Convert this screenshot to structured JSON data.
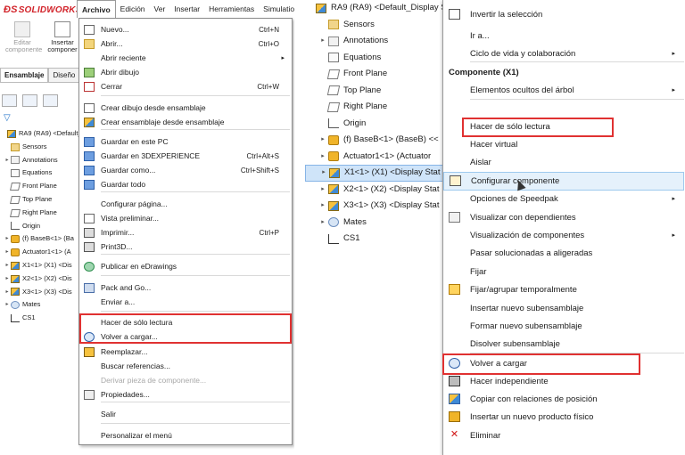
{
  "left": {
    "logo": "SOLIDWORKS",
    "menus": [
      "Archivo",
      "Edición",
      "Ver",
      "Insertar",
      "Herramientas",
      "Simulation"
    ],
    "toolbar": {
      "edit_label": "Editar\ncomponente",
      "insert_label": "Insertar\ncomponer"
    },
    "tabs": [
      "Ensamblaje",
      "Diseño"
    ],
    "tree": [
      {
        "label": "RA9 (RA9) <Default_",
        "icon": "asm",
        "expand": ""
      },
      {
        "label": "Sensors",
        "icon": "folder",
        "expand": ""
      },
      {
        "label": "Annotations",
        "icon": "ann",
        "expand": "▸"
      },
      {
        "label": "Equations",
        "icon": "eq",
        "expand": ""
      },
      {
        "label": "Front Plane",
        "icon": "plane",
        "expand": ""
      },
      {
        "label": "Top Plane",
        "icon": "plane",
        "expand": ""
      },
      {
        "label": "Right Plane",
        "icon": "plane",
        "expand": ""
      },
      {
        "label": "Origin",
        "icon": "origin",
        "expand": ""
      },
      {
        "label": "(f) BaseB<1> (Ba",
        "icon": "part",
        "expand": "▸"
      },
      {
        "label": "Actuator1<1> (A",
        "icon": "part",
        "expand": "▸"
      },
      {
        "label": "X1<1> (X1) <Dis",
        "icon": "asm",
        "expand": "▸"
      },
      {
        "label": "X2<1> (X2) <Dis",
        "icon": "asm",
        "expand": "▸"
      },
      {
        "label": "X3<1> (X3) <Dis",
        "icon": "asm",
        "expand": "▸"
      },
      {
        "label": "Mates",
        "icon": "mates",
        "expand": "▸"
      },
      {
        "label": "CS1",
        "icon": "cs",
        "expand": ""
      }
    ],
    "archivo_menu": {
      "items": [
        {
          "label": "Nuevo...",
          "shortcut": "Ctrl+N",
          "icon": "doc-icon"
        },
        {
          "label": "Abrir...",
          "shortcut": "Ctrl+O",
          "icon": "open-icon"
        },
        {
          "label": "Abrir reciente",
          "shortcut": "",
          "icon": "none",
          "submenu": true
        },
        {
          "label": "Abrir dibujo",
          "shortcut": "",
          "icon": "pic-icon"
        },
        {
          "label": "Cerrar",
          "shortcut": "Ctrl+W",
          "icon": "close-icon"
        },
        {
          "label": "Crear dibujo desde ensamblaje",
          "shortcut": "",
          "icon": "doc-icon"
        },
        {
          "label": "Crear ensamblaje desde ensamblaje",
          "shortcut": "",
          "icon": "asm-icon"
        },
        {
          "label": "Guardar en este PC",
          "shortcut": "",
          "icon": "save-icon"
        },
        {
          "label": "Guardar en 3DEXPERIENCE",
          "shortcut": "Ctrl+Alt+S",
          "icon": "save-icon"
        },
        {
          "label": "Guardar como...",
          "shortcut": "Ctrl+Shift+S",
          "icon": "save-icon"
        },
        {
          "label": "Guardar todo",
          "shortcut": "",
          "icon": "save-icon"
        },
        {
          "label": "Configurar página...",
          "shortcut": "",
          "icon": "none"
        },
        {
          "label": "Vista preliminar...",
          "shortcut": "",
          "icon": "doc-icon"
        },
        {
          "label": "Imprimir...",
          "shortcut": "Ctrl+P",
          "icon": "print-icon"
        },
        {
          "label": "Print3D...",
          "shortcut": "",
          "icon": "print-icon"
        },
        {
          "label": "Publicar en eDrawings",
          "shortcut": "",
          "icon": "edraw-icon"
        },
        {
          "label": "Pack and Go...",
          "shortcut": "",
          "icon": "pack-icon"
        },
        {
          "label": "Enviar a...",
          "shortcut": "",
          "icon": "none"
        },
        {
          "label": "Hacer de sólo lectura",
          "shortcut": "",
          "icon": "none"
        },
        {
          "label": "Volver a cargar...",
          "shortcut": "",
          "icon": "reload-icon"
        },
        {
          "label": "Reemplazar...",
          "shortcut": "",
          "icon": "replace-icon"
        },
        {
          "label": "Buscar referencias...",
          "shortcut": "",
          "icon": "none"
        },
        {
          "label": "Derivar pieza de componente...",
          "shortcut": "",
          "icon": "none",
          "disabled": true
        },
        {
          "label": "Propiedades...",
          "shortcut": "",
          "icon": "props-icon"
        },
        {
          "label": "Salir",
          "shortcut": "",
          "icon": "none"
        },
        {
          "label": "Personalizar el menú",
          "shortcut": "",
          "icon": "none"
        }
      ]
    }
  },
  "right": {
    "tree": [
      {
        "label": "RA9 (RA9) <Default_Display S",
        "icon": "asm",
        "expand": ""
      },
      {
        "label": "Sensors",
        "icon": "folder",
        "expand": ""
      },
      {
        "label": "Annotations",
        "icon": "ann",
        "expand": "▸"
      },
      {
        "label": "Equations",
        "icon": "eq",
        "expand": ""
      },
      {
        "label": "Front Plane",
        "icon": "plane",
        "expand": ""
      },
      {
        "label": "Top Plane",
        "icon": "plane",
        "expand": ""
      },
      {
        "label": "Right Plane",
        "icon": "plane",
        "expand": ""
      },
      {
        "label": "Origin",
        "icon": "origin",
        "expand": ""
      },
      {
        "label": "(f) BaseB<1> (BaseB) <<",
        "icon": "part",
        "expand": "▸"
      },
      {
        "label": "Actuator1<1> (Actuator",
        "icon": "part",
        "expand": "▸"
      },
      {
        "label": "X1<1> (X1) <Display Stat",
        "icon": "asm",
        "expand": "▸",
        "selected": true
      },
      {
        "label": "X2<1> (X2) <Display Stat",
        "icon": "asm",
        "expand": "▸"
      },
      {
        "label": "X3<1> (X3) <Display Stat",
        "icon": "asm",
        "expand": "▸"
      },
      {
        "label": "Mates",
        "icon": "mates",
        "expand": "▸"
      },
      {
        "label": "CS1",
        "icon": "cs",
        "expand": ""
      }
    ],
    "context_menu": {
      "items": [
        {
          "label": "Invertir la selección",
          "icon": "invert-icon"
        },
        {
          "label": "Ir a...",
          "icon": "none"
        },
        {
          "label": "Ciclo de vida y colaboración",
          "icon": "none",
          "submenu": true
        },
        {
          "label": "Componente (X1)",
          "header": true
        },
        {
          "label": "Elementos ocultos del árbol",
          "icon": "none",
          "submenu": true
        },
        {
          "label": "Hacer de sólo lectura",
          "icon": "none"
        },
        {
          "label": "Hacer virtual",
          "icon": "none"
        },
        {
          "label": "Aislar",
          "icon": "none"
        },
        {
          "label": "Configurar componente",
          "icon": "config-icon",
          "hover": true
        },
        {
          "label": "Opciones de Speedpak",
          "icon": "none",
          "submenu": true
        },
        {
          "label": "Visualizar con dependientes",
          "icon": "vis-icon"
        },
        {
          "label": "Visualización de componentes",
          "icon": "none",
          "submenu": true
        },
        {
          "label": "Pasar solucionadas a aligeradas",
          "icon": "none"
        },
        {
          "label": "Fijar",
          "icon": "none"
        },
        {
          "label": "Fijar/agrupar temporalmente",
          "icon": "fix-icon"
        },
        {
          "label": "Insertar nuevo subensamblaje",
          "icon": "none"
        },
        {
          "label": "Formar nuevo subensamblaje",
          "icon": "none"
        },
        {
          "label": "Disolver subensamblaje",
          "icon": "none"
        },
        {
          "label": "Volver a cargar",
          "icon": "reload-icon"
        },
        {
          "label": "Hacer independiente",
          "icon": "indep-icon"
        },
        {
          "label": "Copiar con relaciones de posición",
          "icon": "copy-icon"
        },
        {
          "label": "Insertar un nuevo producto físico",
          "icon": "cube-icon"
        },
        {
          "label": "Eliminar",
          "icon": "delete-icon"
        }
      ]
    }
  }
}
